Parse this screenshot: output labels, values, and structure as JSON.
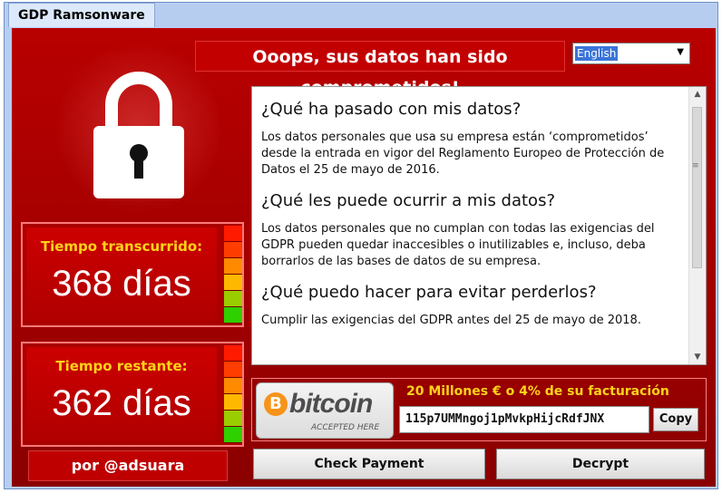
{
  "window": {
    "title": "GDP Ramsonware"
  },
  "header": {
    "headline": "Ooops, sus datos han sido comprometidos!",
    "language": "English"
  },
  "info": {
    "sections": [
      {
        "heading": "¿Qué ha pasado con mis datos?",
        "body": "Los datos personales que usa su empresa están ‘comprometidos’ desde la entrada en vigor del Reglamento Europeo de Protección de Datos el 25 de mayo de 2016."
      },
      {
        "heading": "¿Qué les puede ocurrir a mis datos?",
        "body": "Los datos personales que no cumplan con todas las exigencias del GDPR pueden quedar inaccesibles o inutilizables e, incluso, deba borrarlos de las bases de datos de su empresa."
      },
      {
        "heading": "¿Qué puedo hacer para evitar perderlos?",
        "body": "Cumplir las exigencias del GDPR antes del 25 de mayo de 2018."
      }
    ]
  },
  "timers": {
    "elapsed": {
      "label": "Tiempo transcurrido:",
      "value": "368 días"
    },
    "remaining": {
      "label": "Tiempo restante:",
      "value": "362 días"
    }
  },
  "bar_colors": [
    "#ff1a00",
    "#ff3d00",
    "#ff8a00",
    "#ffb800",
    "#9acd00",
    "#2fd000"
  ],
  "credit": "por @adsuara",
  "payment": {
    "logo_word": "bitcoin",
    "logo_coin": "B",
    "logo_subtitle": "ACCEPTED HERE",
    "amount": "20 Millones € o 4% de su facturación",
    "address": "115p7UMMngoj1pMvkpHijcRdfJNX",
    "copy_label": "Copy"
  },
  "buttons": {
    "check": "Check Payment",
    "decrypt": "Decrypt"
  },
  "colors": {
    "background_red": "#b80000",
    "timer_label": "#ffd21a",
    "bitcoin_orange": "#f7931a"
  }
}
